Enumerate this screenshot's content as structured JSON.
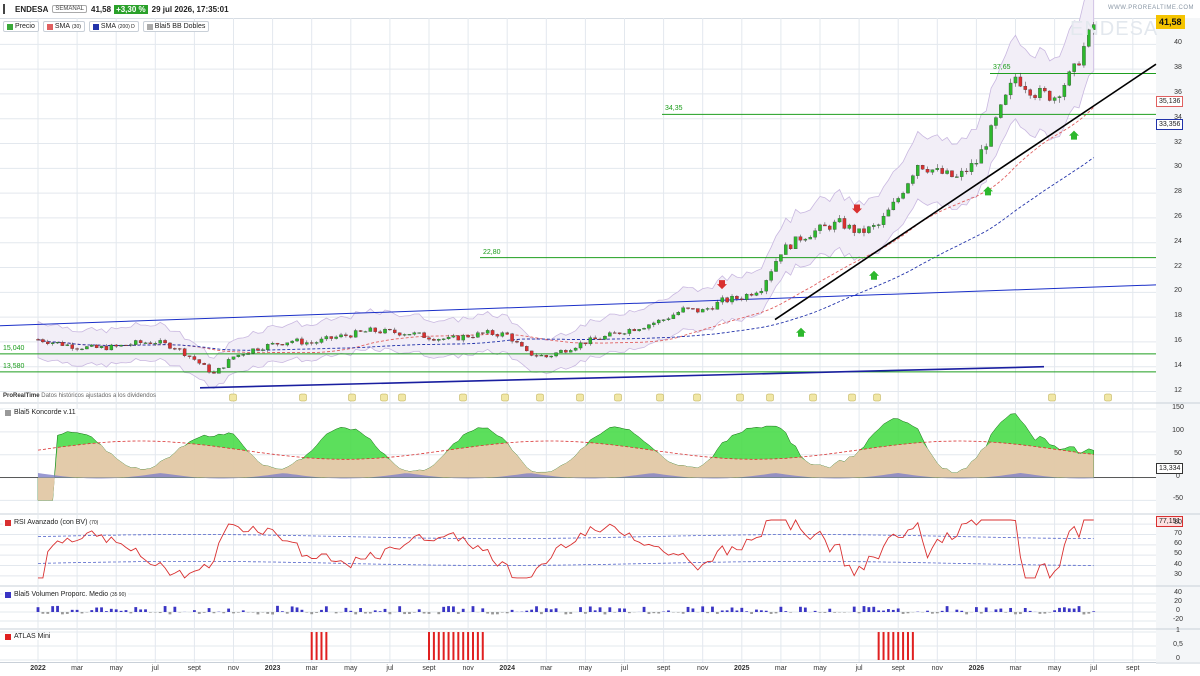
{
  "header": {
    "ticker": "ENDESA",
    "timeframe": "SEMANAL",
    "last": "41,58",
    "change": "+3,30 %",
    "timestamp": "29 jul 2026, 17:35:01",
    "brand": "WWW.PROREALTIME.COM",
    "watermark": "ENDESA",
    "last_box": "41,58"
  },
  "legend": [
    {
      "label": "Precio",
      "color": "#3aa83a",
      "param": ""
    },
    {
      "label": "SMA",
      "color": "#e06060",
      "param": "(30)"
    },
    {
      "label": "SMA",
      "color": "#2233aa",
      "param": "(200) D"
    },
    {
      "label": "Blai5 BB Dobles",
      "color": "#aaaaaa",
      "param": ""
    }
  ],
  "price_axis": {
    "ticks": [
      "40",
      "38",
      "36",
      "34",
      "32",
      "30",
      "28",
      "26",
      "24",
      "22",
      "20",
      "18",
      "16",
      "14",
      "12"
    ]
  },
  "value_boxes": {
    "sma30": "35,136",
    "sma200": "33,356",
    "koncorde": "13,334",
    "rsi": "77,151"
  },
  "levels": [
    {
      "label": "37,65",
      "value": 37.65
    },
    {
      "label": "34,35",
      "value": 34.35
    },
    {
      "label": "22,80",
      "value": 22.8
    },
    {
      "label": "15,040",
      "value": 15.04
    },
    {
      "label": "13,580",
      "value": 13.58
    }
  ],
  "credits": {
    "brand": "ProRealTime",
    "text": "Datos históricos ajustados a los dividendos"
  },
  "panels": {
    "koncorde": {
      "title": "Blai5 Koncorde v.11",
      "param": "",
      "ticks": [
        "150",
        "100",
        "50",
        "0",
        "-50"
      ]
    },
    "rsi": {
      "title": "RSI Avanzado (con BV)",
      "param": "(70)",
      "ticks": [
        "80",
        "70",
        "60",
        "50",
        "40",
        "30"
      ]
    },
    "volume": {
      "title": "Blai5 Volumen Proporc. Medio",
      "param": "(35 90)",
      "ticks": [
        "40",
        "20",
        "0",
        "-20"
      ]
    },
    "atlas": {
      "title": "ATLAS Mini",
      "param": "",
      "ticks": [
        "1",
        "0,5",
        "0"
      ]
    }
  },
  "x_axis": {
    "labels": [
      {
        "t": "2022",
        "bold": true
      },
      {
        "t": "mar"
      },
      {
        "t": "may"
      },
      {
        "t": "jul"
      },
      {
        "t": "sept"
      },
      {
        "t": "nov"
      },
      {
        "t": "2023",
        "bold": true
      },
      {
        "t": "mar"
      },
      {
        "t": "may"
      },
      {
        "t": "jul"
      },
      {
        "t": "sept"
      },
      {
        "t": "nov"
      },
      {
        "t": "2024",
        "bold": true
      },
      {
        "t": "mar"
      },
      {
        "t": "may"
      },
      {
        "t": "jul"
      },
      {
        "t": "sept"
      },
      {
        "t": "nov"
      },
      {
        "t": "2025",
        "bold": true
      },
      {
        "t": "mar"
      },
      {
        "t": "may"
      },
      {
        "t": "jul"
      },
      {
        "t": "sept"
      },
      {
        "t": "nov"
      },
      {
        "t": "2026",
        "bold": true
      },
      {
        "t": "mar"
      },
      {
        "t": "may"
      },
      {
        "t": "jul"
      },
      {
        "t": "sept"
      }
    ]
  },
  "colors": {
    "up": "#2db82d",
    "down": "#d93030",
    "grid": "#e3e8ee",
    "trend_blue": "#1a2fc8",
    "level_green": "#1f9e1f",
    "atlas": "#e02020",
    "volume": "#3a35c4"
  },
  "chart_data": {
    "type": "candlestick",
    "x_range": [
      "2022-01",
      "2026-09"
    ],
    "price_ylim": [
      12,
      41.6
    ],
    "close_series": {
      "name": "Precio",
      "points": [
        [
          "2022-01",
          16.2
        ],
        [
          "2022-02",
          15.9
        ],
        [
          "2022-03",
          15.6
        ],
        [
          "2022-04",
          15.5
        ],
        [
          "2022-05",
          15.6
        ],
        [
          "2022-06",
          15.9
        ],
        [
          "2022-07",
          16.0
        ],
        [
          "2022-08",
          15.6
        ],
        [
          "2022-09",
          14.6
        ],
        [
          "2022-10",
          13.4
        ],
        [
          "2022-11",
          14.8
        ],
        [
          "2022-12",
          15.4
        ],
        [
          "2023-01",
          15.8
        ],
        [
          "2023-02",
          16.1
        ],
        [
          "2023-03",
          15.9
        ],
        [
          "2023-04",
          16.3
        ],
        [
          "2023-05",
          16.6
        ],
        [
          "2023-06",
          16.9
        ],
        [
          "2023-07",
          16.8
        ],
        [
          "2023-08",
          16.7
        ],
        [
          "2023-09",
          16.4
        ],
        [
          "2023-10",
          16.2
        ],
        [
          "2023-11",
          16.5
        ],
        [
          "2023-12",
          16.7
        ],
        [
          "2024-01",
          16.6
        ],
        [
          "2024-02",
          15.1
        ],
        [
          "2024-03",
          14.8
        ],
        [
          "2024-04",
          15.4
        ],
        [
          "2024-05",
          16.0
        ],
        [
          "2024-06",
          16.4
        ],
        [
          "2024-07",
          16.9
        ],
        [
          "2024-08",
          17.3
        ],
        [
          "2024-09",
          17.8
        ],
        [
          "2024-10",
          18.6
        ],
        [
          "2024-11",
          18.5
        ],
        [
          "2024-12",
          19.3
        ],
        [
          "2025-01",
          19.6
        ],
        [
          "2025-02",
          20.4
        ],
        [
          "2025-03",
          23.3
        ],
        [
          "2025-04",
          24.4
        ],
        [
          "2025-05",
          25.1
        ],
        [
          "2025-06",
          25.6
        ],
        [
          "2025-07",
          24.8
        ],
        [
          "2025-08",
          25.4
        ],
        [
          "2025-09",
          27.6
        ],
        [
          "2025-10",
          30.4
        ],
        [
          "2025-11",
          29.7
        ],
        [
          "2025-12",
          29.2
        ],
        [
          "2026-01",
          30.5
        ],
        [
          "2026-02",
          33.8
        ],
        [
          "2026-03",
          37.4
        ],
        [
          "2026-04",
          36.1
        ],
        [
          "2026-05",
          35.8
        ],
        [
          "2026-06",
          37.9
        ],
        [
          "2026-07",
          41.58
        ]
      ]
    },
    "sma30": {
      "name": "SMA (30)",
      "last": 35.136
    },
    "sma200": {
      "name": "SMA (200) D",
      "last": 33.356
    },
    "rsi_last": 77.151,
    "koncorde_last": 13.334,
    "atlas_active_periods": [
      [
        "2023-03",
        "2023-03"
      ],
      [
        "2023-09",
        "2023-11"
      ],
      [
        "2025-08",
        "2025-09"
      ]
    ]
  }
}
